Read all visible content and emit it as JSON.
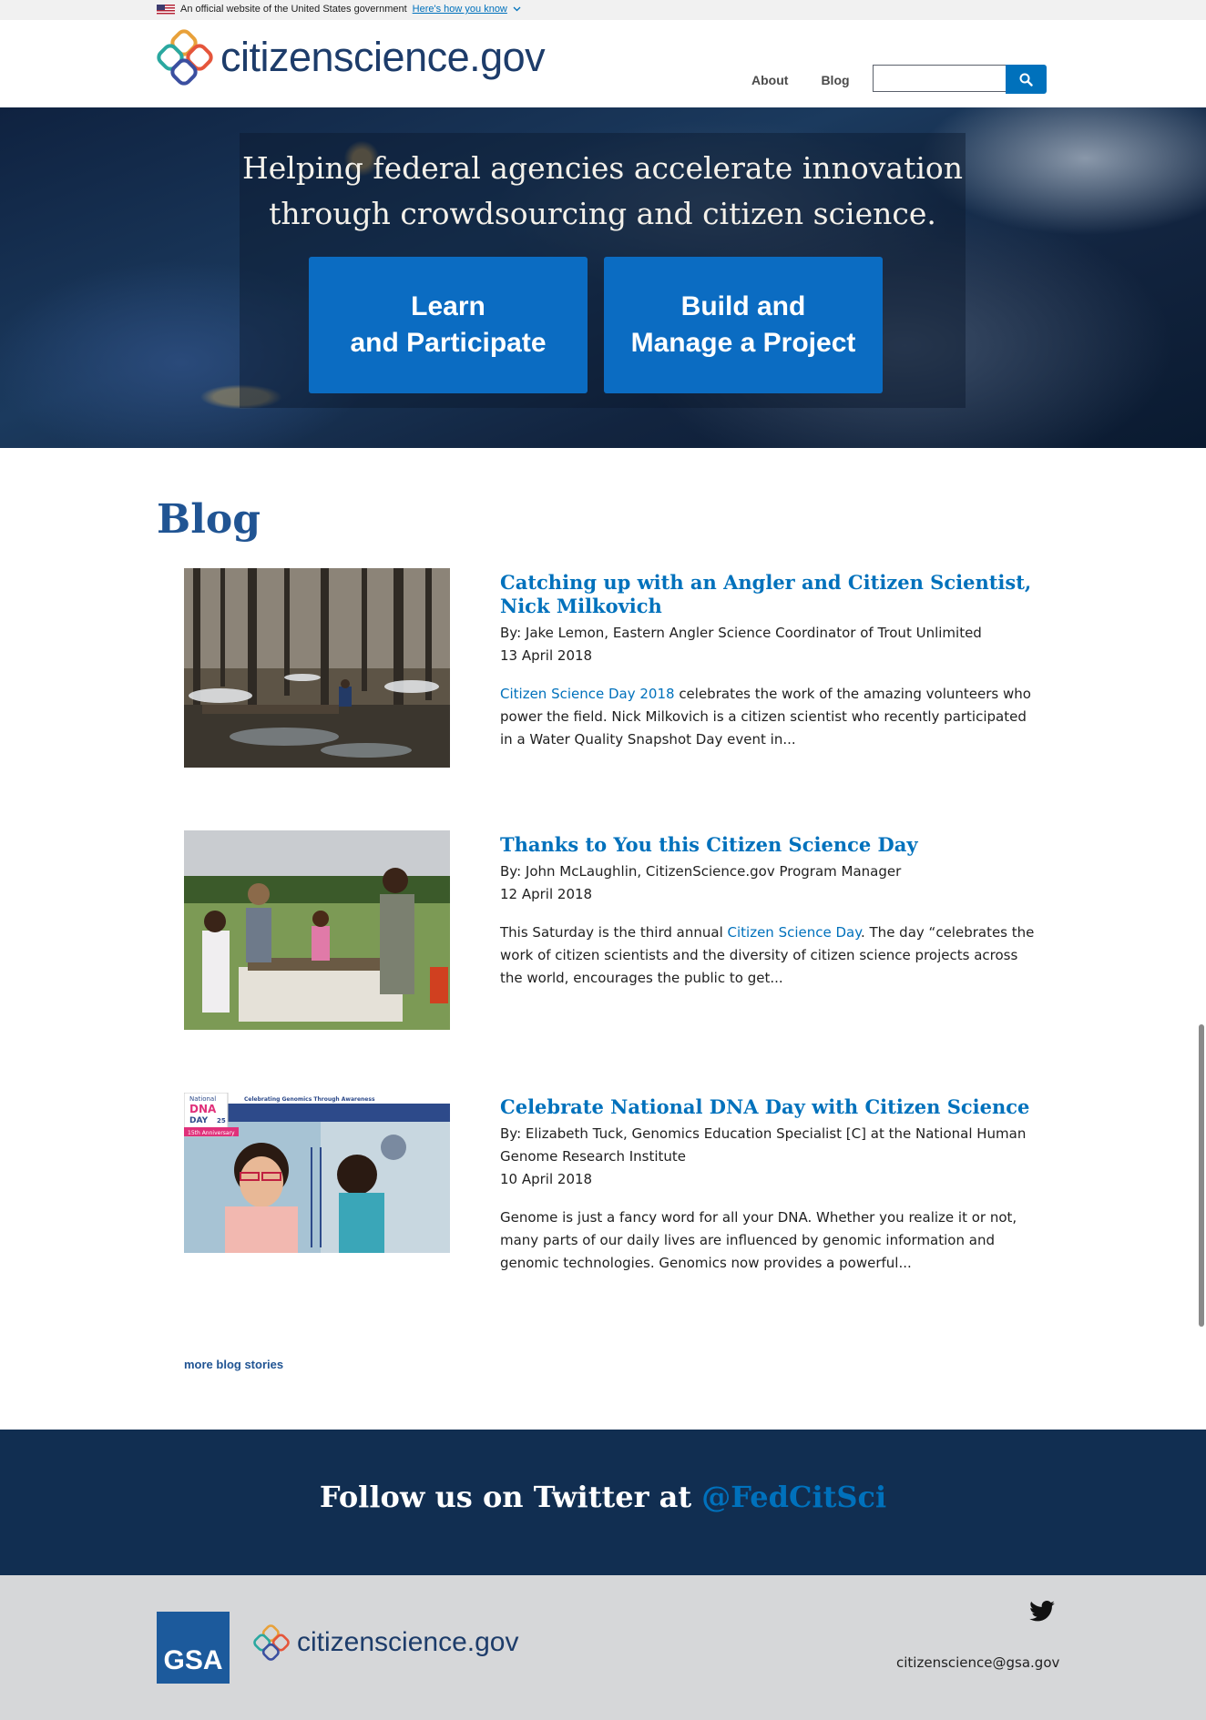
{
  "gov_banner": {
    "text": "An official website of the United States government",
    "link": "Here's how you know"
  },
  "header": {
    "logo_text": "citizenscience.gov",
    "nav": [
      "About",
      "Blog"
    ],
    "search": {
      "placeholder": "",
      "button_icon": "search-icon"
    }
  },
  "hero": {
    "tagline_line1": "Helping federal agencies accelerate innovation",
    "tagline_line2": "through crowdsourcing and citizen science.",
    "btn_learn_line1": "Learn",
    "btn_learn_line2": "and Participate",
    "btn_build_line1": "Build and",
    "btn_build_line2": "Manage a Project"
  },
  "blog": {
    "heading": "Blog",
    "posts": [
      {
        "title": "Catching up with an Angler and Citizen Scientist, Nick Milkovich",
        "author": "By: Jake Lemon, Eastern Angler Science Coordinator of Trout Unlimited",
        "date": "13 April 2018",
        "excerpt_link": "Citizen Science Day 2018",
        "excerpt_rest": " celebrates the work of the amazing volunteers who power the field. Nick Milkovich is a citizen scientist who recently participated in a Water Quality Snapshot Day event in..."
      },
      {
        "title": "Thanks to You this Citizen Science Day",
        "author": "By: John McLaughlin, CitizenScience.gov Program Manager",
        "date": "12 April 2018",
        "excerpt_pre": "This Saturday is the third annual ",
        "excerpt_link": "Citizen Science Day",
        "excerpt_rest": ". The day “celebrates the work of citizen scientists and the diversity of citizen science projects across the world, encourages the public to get..."
      },
      {
        "title": "Celebrate National DNA Day with Citizen Science",
        "author": "By: Elizabeth Tuck, Genomics Education Specialist [C] at the National Human Genome Research Institute",
        "date": "10 April 2018",
        "excerpt_rest": "Genome is just a fancy word for all your DNA. Whether you realize it or not, many parts of our daily lives are influenced by genomic information and genomic technologies. Genomics now provides a powerful...",
        "image_caption_top": "Celebrating Genomics Through Awareness",
        "image_badge": "National DNA DAY",
        "image_badge_num": "25",
        "image_anniv": "15th Anniversary"
      }
    ],
    "more_label": "more blog stories"
  },
  "twitter": {
    "text": "Follow us on Twitter at ",
    "handle": "@FedCitSci"
  },
  "footer": {
    "gsa": "GSA",
    "logo_text": "citizenscience.gov",
    "email": "citizenscience@gsa.gov"
  },
  "colors": {
    "primary_blue": "#0071bc",
    "dark_blue": "#205493",
    "navy": "#112e51",
    "footer_gray": "#d6d7d9"
  }
}
